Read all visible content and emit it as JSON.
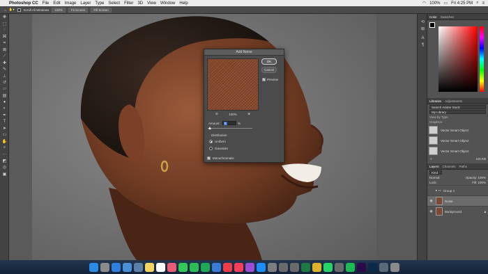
{
  "menubar": {
    "app": "Photoshop CC",
    "items": [
      "File",
      "Edit",
      "Image",
      "Layer",
      "Type",
      "Select",
      "Filter",
      "3D",
      "View",
      "Window",
      "Help"
    ],
    "battery": "100%",
    "clock": "Fri 4:25 PM"
  },
  "optionsbar": {
    "scroll_all": "Scroll All Windows",
    "zoom": "100%",
    "fit_screen": "Fit Screen",
    "fill_screen": "Fill Screen"
  },
  "dialog": {
    "title": "Add Noise",
    "ok": "OK",
    "cancel": "Cancel",
    "preview": "Preview",
    "zoom": "100%",
    "amount_label": "Amount:",
    "amount_value": "5",
    "amount_unit": "%",
    "amount_percent": 5,
    "distribution": "Distribution",
    "uniform": "Uniform",
    "gaussian": "Gaussian",
    "monochromatic": "Monochromatic"
  },
  "color_panel": {
    "tabs": [
      "Color",
      "Swatches"
    ],
    "hue_color": "#ff0000"
  },
  "libraries": {
    "tabs": [
      "Libraries",
      "Adjustments"
    ],
    "search_placeholder": "Search Adobe Stock",
    "library": "My Library",
    "view": "View by Type",
    "group": "Graphics",
    "items": [
      "Vector Smart Object",
      "Vector Smart Object",
      "Vector Smart Object"
    ],
    "size": "116 KB"
  },
  "layers": {
    "tabs": [
      "Layers",
      "Channels",
      "Paths"
    ],
    "kind": "Kind",
    "blend": "Normal",
    "opacity": "Opacity: 100%",
    "lock": "Lock:",
    "fill": "Fill: 100%",
    "rows": [
      {
        "name": "Group 4"
      },
      {
        "name": "Noise"
      },
      {
        "name": "Background"
      }
    ]
  },
  "dock": {
    "apps": [
      {
        "name": "finder-icon",
        "color": "#2a8be6"
      },
      {
        "name": "launchpad-icon",
        "color": "#8a8a8a"
      },
      {
        "name": "safari-icon",
        "color": "#2f7fdf"
      },
      {
        "name": "mail-icon",
        "color": "#4a90d9"
      },
      {
        "name": "preview-icon",
        "color": "#5c7fa8"
      },
      {
        "name": "notes-icon",
        "color": "#f4d35e"
      },
      {
        "name": "calendar-icon",
        "color": "#ffffff"
      },
      {
        "name": "photos-icon",
        "color": "#e85d75"
      },
      {
        "name": "messages-icon",
        "color": "#34c759"
      },
      {
        "name": "facetime-icon",
        "color": "#2dbd56"
      },
      {
        "name": "numbers-icon",
        "color": "#1fa855"
      },
      {
        "name": "keynote-icon",
        "color": "#3b7bd6"
      },
      {
        "name": "news-icon",
        "color": "#ef3e4a"
      },
      {
        "name": "music-icon",
        "color": "#fa3d5b"
      },
      {
        "name": "podcasts-icon",
        "color": "#9b4dd6"
      },
      {
        "name": "appstore-icon",
        "color": "#1c8ef9"
      },
      {
        "name": "settings-icon",
        "color": "#7d7d7d"
      },
      {
        "name": "help-icon",
        "color": "#6a6a6a"
      },
      {
        "name": "help-icon",
        "color": "#6a6a6a"
      },
      {
        "name": "excel-icon",
        "color": "#1d7a43"
      },
      {
        "name": "chrome-icon",
        "color": "#e0b12a"
      },
      {
        "name": "whatsapp-icon",
        "color": "#25d366"
      },
      {
        "name": "help-icon",
        "color": "#6a6a6a"
      },
      {
        "name": "spotify-icon",
        "color": "#1db954"
      },
      {
        "name": "premiere-icon",
        "color": "#2a0a4a"
      },
      {
        "name": "photoshop-icon",
        "color": "#0b2a4a"
      },
      {
        "name": "downloads-icon",
        "color": "#5a6a7a"
      },
      {
        "name": "trash-icon",
        "color": "#8a8a8a"
      }
    ]
  }
}
